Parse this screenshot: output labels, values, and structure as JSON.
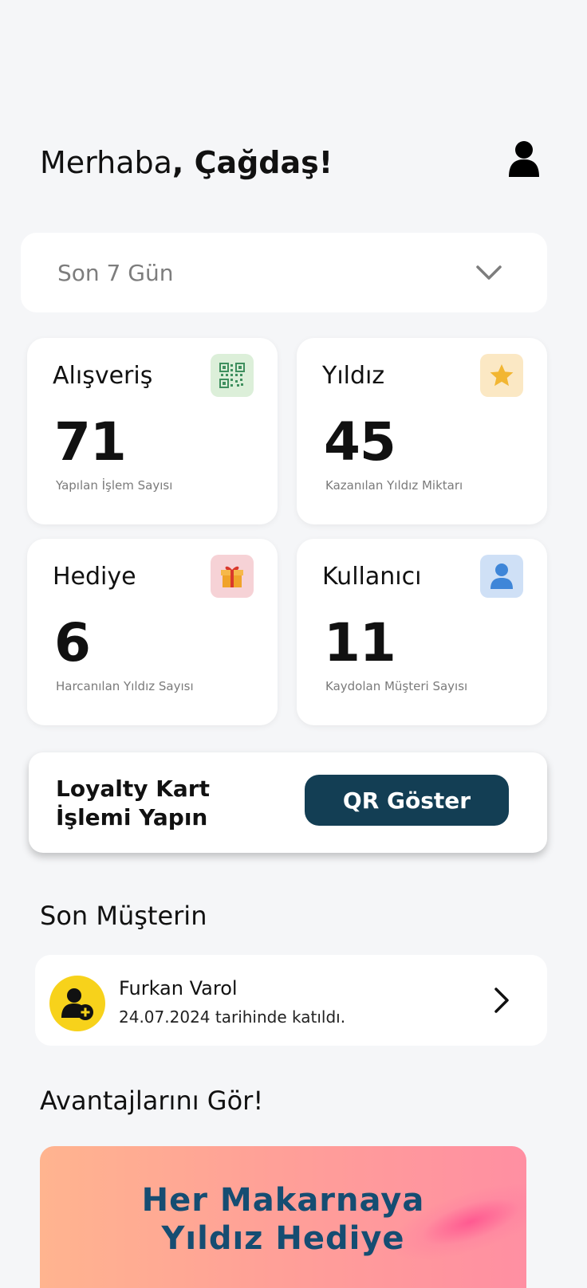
{
  "header": {
    "greeting_prefix": "Merhaba",
    "greeting_name": ", Çağdaş!",
    "profile_icon": "user-icon"
  },
  "period": {
    "selected": "Son 7 Gün",
    "icon": "chevron-down-icon"
  },
  "stats": [
    {
      "title": "Alışveriş",
      "value": "71",
      "subtitle": "Yapılan İşlem Sayısı",
      "icon": "qr-code-icon",
      "badge_color": "#dcefd9"
    },
    {
      "title": "Yıldız",
      "value": "45",
      "subtitle": "Kazanılan Yıldız Miktarı",
      "icon": "star-icon",
      "badge_color": "#fbe8c4"
    },
    {
      "title": "Hediye",
      "value": "6",
      "subtitle": "Harcanılan Yıldız Sayısı",
      "icon": "gift-icon",
      "badge_color": "#f6d2d6"
    },
    {
      "title": "Kullanıcı",
      "value": "11",
      "subtitle": "Kaydolan Müşteri Sayısı",
      "icon": "user-icon",
      "badge_color": "#cfe0f6"
    }
  ],
  "loyalty": {
    "line1": "Loyalty Kart",
    "line2": "İşlemi Yapın",
    "button_label": "QR Göster",
    "button_color": "#133e54"
  },
  "recent_customers": {
    "title": "Son Müşterin",
    "items": [
      {
        "name": "Furkan Varol",
        "joined": "24.07.2024 tarihinde katıldı.",
        "icon": "user-add-icon",
        "avatar_color": "#f7d21b"
      }
    ]
  },
  "advantages": {
    "title": "Avantajlarını Gör!",
    "promo_line1": "Her Makarnaya",
    "promo_line2": "Yıldız Hediye",
    "promo_text_color": "#154d72"
  }
}
